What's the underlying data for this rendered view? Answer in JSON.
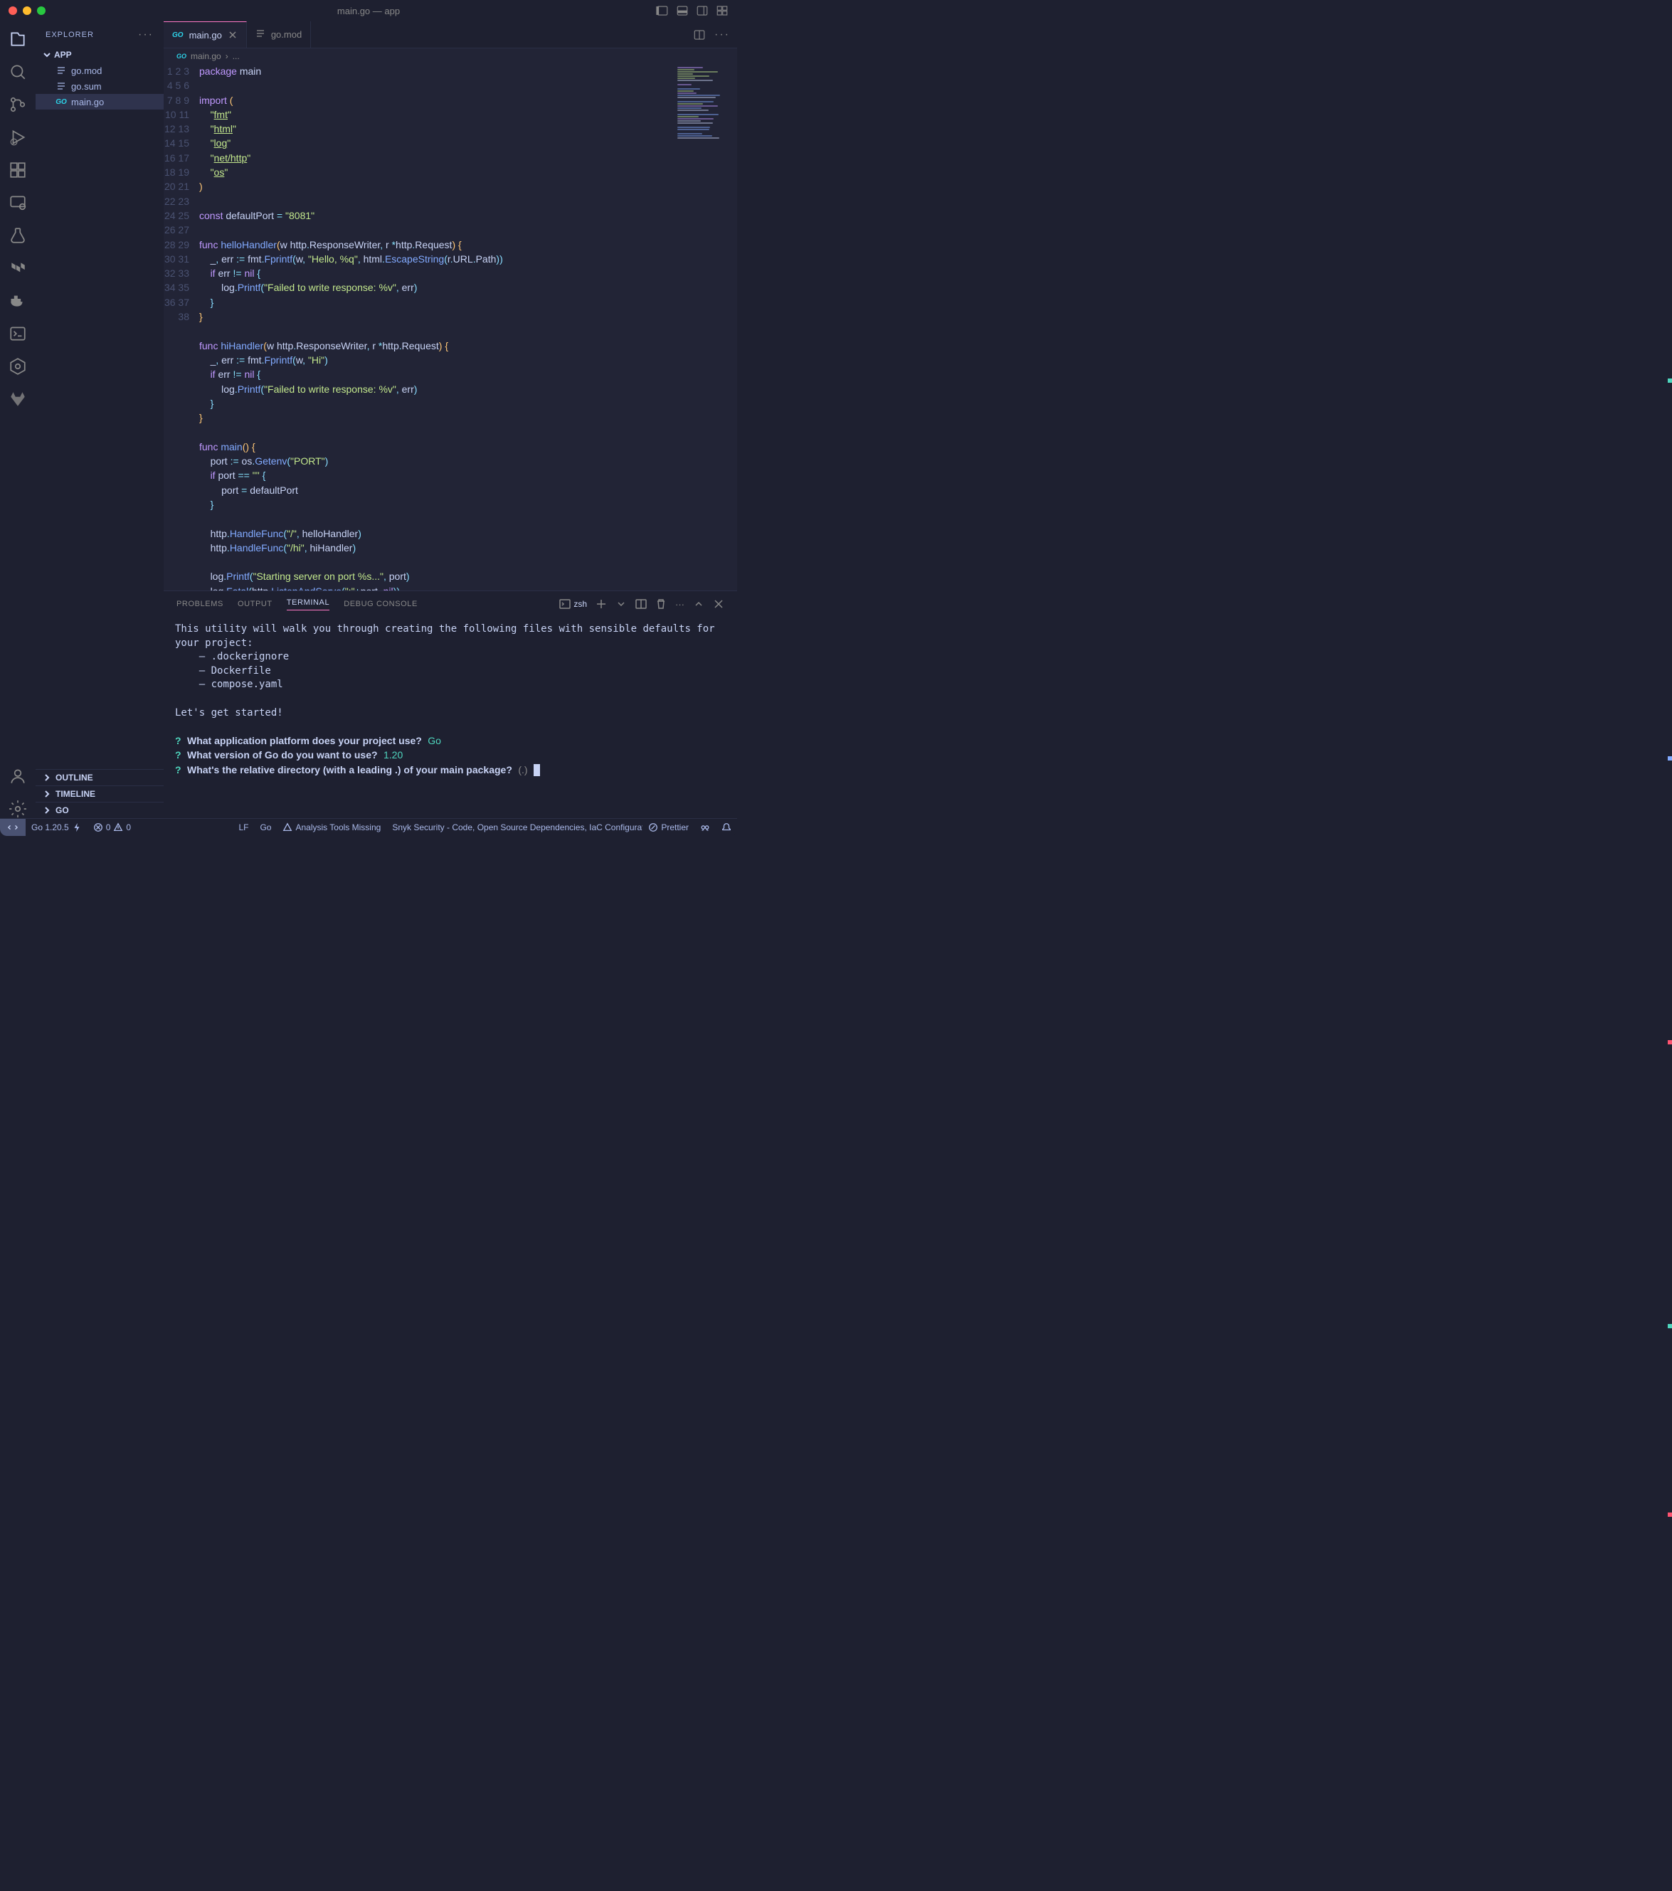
{
  "window": {
    "title": "main.go — app"
  },
  "sidebar": {
    "title": "EXPLORER",
    "section": "APP",
    "items": [
      {
        "name": "go.mod",
        "type": "txt"
      },
      {
        "name": "go.sum",
        "type": "txt"
      },
      {
        "name": "main.go",
        "type": "go",
        "selected": true
      }
    ],
    "outline": "OUTLINE",
    "timeline": "TIMELINE",
    "go": "GO"
  },
  "tabs": [
    {
      "label": "main.go",
      "type": "go",
      "active": true,
      "close": true
    },
    {
      "label": "go.mod",
      "type": "txt",
      "active": false
    }
  ],
  "breadcrumb": {
    "file": "main.go",
    "sep": "›",
    "rest": "..."
  },
  "panel": {
    "tabs": [
      "PROBLEMS",
      "OUTPUT",
      "TERMINAL",
      "DEBUG CONSOLE"
    ],
    "active": "TERMINAL",
    "shell": "zsh"
  },
  "terminal": {
    "intro": "This utility will walk you through creating the following files with sensible defaults for your project:",
    "files": [
      ". dockerignore",
      "Dockerfile",
      "compose.yaml"
    ],
    "started": "Let's get started!",
    "prompts": [
      {
        "q": "What application platform does your project use?",
        "a": "Go"
      },
      {
        "q": "What version of Go do you want to use?",
        "a": "1.20"
      },
      {
        "q": "What's the relative directory (with a leading .) of your main package?",
        "hint": "(.)"
      }
    ]
  },
  "status": {
    "go": "Go 1.20.5",
    "errors": "0",
    "warnings": "0",
    "eol": "LF",
    "lang": "Go",
    "analysis": "Analysis Tools Missing",
    "snyk": "Snyk Security - Code, Open Source Dependencies, IaC Configuratio",
    "prettier": "Prettier"
  },
  "code_lines": 38
}
